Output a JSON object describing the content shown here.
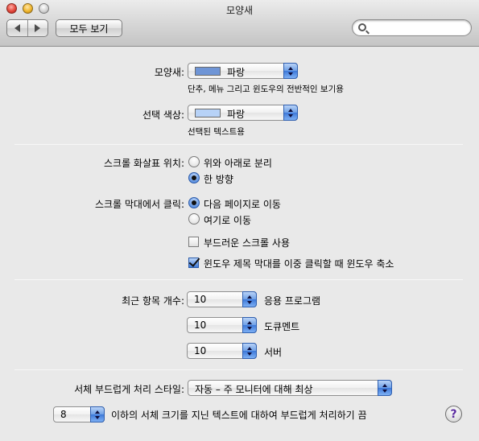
{
  "window": {
    "title": "모양새",
    "show_all_label": "모두 보기",
    "search_placeholder": "",
    "search_value": ""
  },
  "appearance": {
    "label": "모양새:",
    "value": "파랑",
    "swatch_color": "#6f95d6",
    "description": "단추, 메뉴 그리고 윈도우의 전반적인 보기용"
  },
  "highlight": {
    "label": "선택 색상:",
    "value": "파랑",
    "swatch_color": "#b7d2f7",
    "description": "선택된 텍스트용"
  },
  "scroll_arrows": {
    "label": "스크롤 화살표 위치:",
    "options": [
      {
        "label": "위와 아래로 분리",
        "selected": false
      },
      {
        "label": "한 방향",
        "selected": true
      }
    ]
  },
  "scroll_click": {
    "label": "스크롤 막대에서 클릭:",
    "options": [
      {
        "label": "다음 페이지로 이동",
        "selected": true
      },
      {
        "label": "여기로 이동",
        "selected": false
      }
    ]
  },
  "checkboxes": [
    {
      "label": "부드러운 스크롤 사용",
      "checked": false
    },
    {
      "label": "윈도우 제목 막대를 이중 클릭할 때 윈도우 축소",
      "checked": true
    }
  ],
  "recent_items": {
    "label": "최근 항목 개수:",
    "rows": [
      {
        "value": "10",
        "suffix": "응용 프로그램"
      },
      {
        "value": "10",
        "suffix": "도큐멘트"
      },
      {
        "value": "10",
        "suffix": "서버"
      }
    ]
  },
  "font_smoothing": {
    "label": "서체 부드럽게 처리 스타일:",
    "value": "자동 – 주 모니터에 대해 최상"
  },
  "smoothing_threshold": {
    "value": "8",
    "suffix": "이하의 서체 크기를 지닌 텍스트에 대하여 부드럽게 처리하기 끔"
  },
  "help": {
    "glyph": "?"
  }
}
